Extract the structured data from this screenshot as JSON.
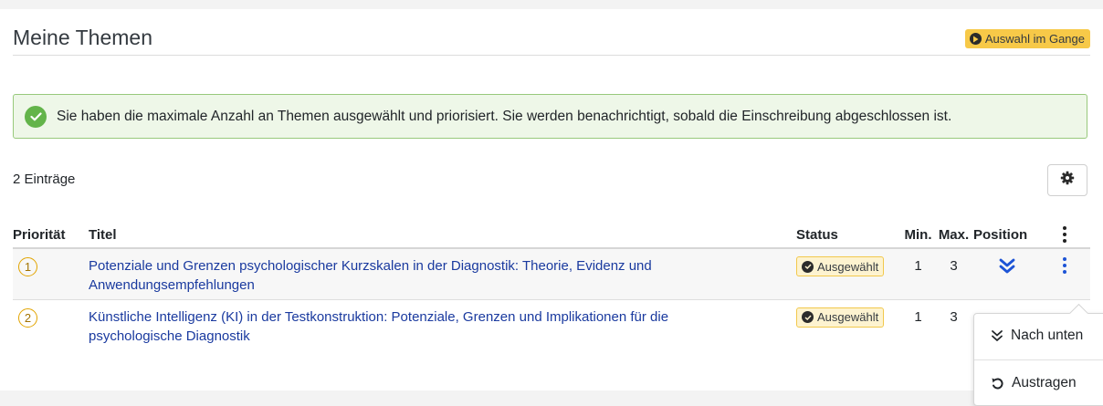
{
  "header": {
    "title": "Meine Themen",
    "status_chip": "Auswahl im Gange",
    "status_icon": "play-circle-icon"
  },
  "alert": {
    "icon": "check-circle-icon",
    "text": "Sie haben die maximale Anzahl an Themen ausgewählt und priorisiert. Sie werden benachrichtigt, sobald die Einschreibung abgeschlossen ist."
  },
  "list": {
    "entries_count": "2 Einträge",
    "settings_icon": "gear-icon"
  },
  "table": {
    "columns": [
      "Priorität",
      "Titel",
      "Status",
      "Min.",
      "Max.",
      "Position"
    ],
    "rows": [
      {
        "priority": "1",
        "title": "Potenziale und Grenzen psychologischer Kurzskalen in der Diagnostik: Theorie, Evidenz und Anwendungsempfehlungen",
        "status": "Ausgewählt",
        "min": "1",
        "max": "3"
      },
      {
        "priority": "2",
        "title": "Künstliche Intelligenz (KI) in der Testkonstruktion: Potenziale, Grenzen und Implikationen für die psychologische Diagnostik",
        "status": "Ausgewählt",
        "min": "1",
        "max": "3"
      }
    ]
  },
  "dropdown": {
    "move_down": "Nach unten",
    "withdraw": "Austragen"
  },
  "colors": {
    "link": "#1a3a9f",
    "accent_blue": "#1d54d6",
    "warning": "#f7c948",
    "success": "#63b44a"
  }
}
